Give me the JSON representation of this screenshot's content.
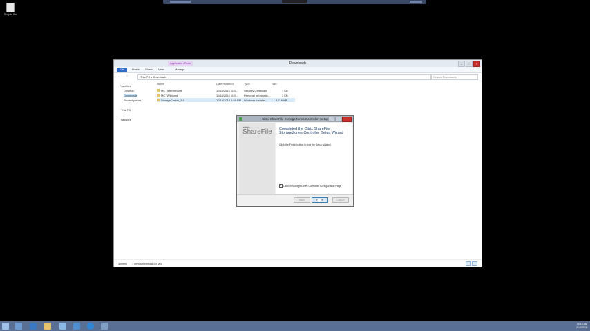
{
  "desktop": {
    "recycle_bin_label": "Recycle Bin"
  },
  "explorer": {
    "title": "Downloads",
    "context_tab": "Application Tools",
    "ribbon_tabs": [
      "File",
      "Home",
      "Share",
      "View",
      "Manage"
    ],
    "address": "This PC  ▸  Downloads",
    "search_placeholder": "Search Downloads",
    "nav": {
      "favorites": "Favorites",
      "desktop": "Desktop",
      "downloads": "Downloads",
      "recent": "Recent places",
      "this_pc": "This PC",
      "network": "Network"
    },
    "columns": {
      "name": "Name",
      "date": "Date modified",
      "type": "Type",
      "size": "Size"
    },
    "files": [
      {
        "name": "MCTIntermediate",
        "date": "11/18/2014 11:0...",
        "type": "Security Certificate",
        "size": "1 KB"
      },
      {
        "name": "MCTWildcard",
        "date": "11/18/2014 11:0...",
        "type": "Personal Informatio...",
        "size": "3 KB"
      },
      {
        "name": "StorageCenter_3.0",
        "date": "10/16/2014 1:59 PM",
        "type": "Windows Installer...",
        "size": "8,716 KB"
      }
    ],
    "status": {
      "items": "3 items",
      "selected": "1 item selected  8.50 MB"
    }
  },
  "dialog": {
    "title": "Citrix ShareFile StorageZones Controller Setup",
    "brand_small": "citrix",
    "brand_large": "ShareFile",
    "heading": "Completed the Citrix ShareFile StorageZones Controller Setup Wizard",
    "body": "Click the Finish button to exit the Setup Wizard.",
    "checkbox_label": "Launch StorageZones Controller Configuration Page",
    "buttons": {
      "back": "Back",
      "finish": "Finish",
      "cancel": "Cancel"
    }
  },
  "taskbar": {
    "time": "10:15 AM",
    "date": "2/16/2015"
  }
}
